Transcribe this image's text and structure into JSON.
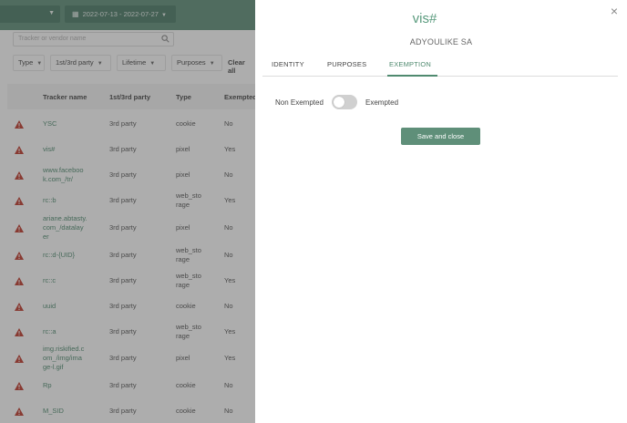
{
  "background": {
    "date_range": "2022-07-13 - 2022-07-27",
    "search": {
      "placeholder": "Tracker or vendor name"
    },
    "filters": {
      "type": "Type",
      "party": "1st/3rd party",
      "lifetime": "Lifetime",
      "purposes": "Purposes",
      "clear_all": "Clear all"
    },
    "table": {
      "headers": {
        "name": "Tracker name",
        "party": "1st/3rd party",
        "type": "Type",
        "exempted": "Exempted"
      },
      "rows": [
        {
          "name": "YSC",
          "party": "3rd party",
          "type": "cookie",
          "exempted": "No"
        },
        {
          "name": "vis#",
          "party": "3rd party",
          "type": "pixel",
          "exempted": "Yes"
        },
        {
          "name": "www.faceboo\nk.com_/tr/",
          "party": "3rd party",
          "type": "pixel",
          "exempted": "No"
        },
        {
          "name": "rc::b",
          "party": "3rd party",
          "type": "web_sto\nrage",
          "exempted": "Yes"
        },
        {
          "name": "ariane.abtasty.\ncom_/datalay\ner",
          "party": "3rd party",
          "type": "pixel",
          "exempted": "No"
        },
        {
          "name": "rc::d-{UID}",
          "party": "3rd party",
          "type": "web_sto\nrage",
          "exempted": "No"
        },
        {
          "name": "rc::c",
          "party": "3rd party",
          "type": "web_sto\nrage",
          "exempted": "Yes"
        },
        {
          "name": "uuid",
          "party": "3rd party",
          "type": "cookie",
          "exempted": "No"
        },
        {
          "name": "rc::a",
          "party": "3rd party",
          "type": "web_sto\nrage",
          "exempted": "Yes"
        },
        {
          "name": "img.riskified.c\nom_/img/ima\nge-l.gif",
          "party": "3rd party",
          "type": "pixel",
          "exempted": "Yes"
        },
        {
          "name": "Rp",
          "party": "3rd party",
          "type": "cookie",
          "exempted": "No"
        },
        {
          "name": "M_SID",
          "party": "3rd party",
          "type": "cookie",
          "exempted": "No"
        }
      ]
    }
  },
  "modal": {
    "title": "vis#",
    "vendor": "ADYOULIKE SA",
    "tabs": [
      "IDENTITY",
      "PURPOSES",
      "EXEMPTION"
    ],
    "active_tab": "EXEMPTION",
    "toggle": {
      "left_label": "Non Exempted",
      "right_label": "Exempted",
      "checked": false
    },
    "save_label": "Save and close"
  },
  "colors": {
    "accent": "#5f8f79",
    "accent_text": "#4f8a6f",
    "warning": "#c0392b"
  }
}
